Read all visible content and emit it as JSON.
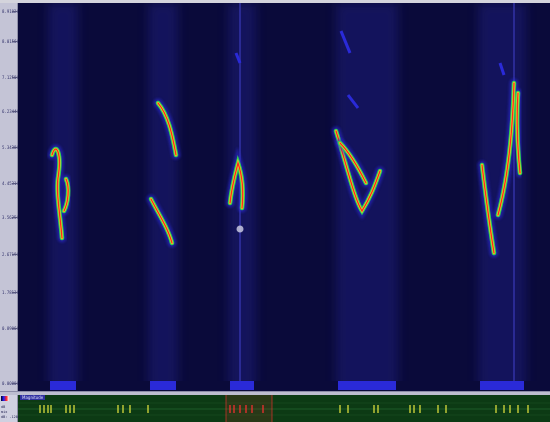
{
  "axis": {
    "ticks": [
      {
        "label": "8.9102k",
        "v": 0.985
      },
      {
        "label": "8.0156k",
        "v": 0.905
      },
      {
        "label": "7.1250k",
        "v": 0.81
      },
      {
        "label": "6.2344k",
        "v": 0.72
      },
      {
        "label": "5.3438k",
        "v": 0.625
      },
      {
        "label": "4.4531k",
        "v": 0.53
      },
      {
        "label": "3.5625k",
        "v": 0.44
      },
      {
        "label": "2.6719k",
        "v": 0.34
      },
      {
        "label": "1.7813k",
        "v": 0.24
      },
      {
        "label": "0.8906k",
        "v": 0.145
      },
      {
        "label": "0.0000k",
        "v": 0.0
      }
    ]
  },
  "legend": {
    "title": "Magnitude",
    "lines": [
      "dB",
      "mix",
      "dB: -120"
    ]
  },
  "track": {
    "label": "Magnitude"
  },
  "colors": {
    "background": "#0a0a3a",
    "low": "#2a2ad8",
    "mid": "#30d050",
    "high": "#ff2a1a",
    "trackPulse": "#e8e840",
    "selection": "#ff3030"
  }
}
